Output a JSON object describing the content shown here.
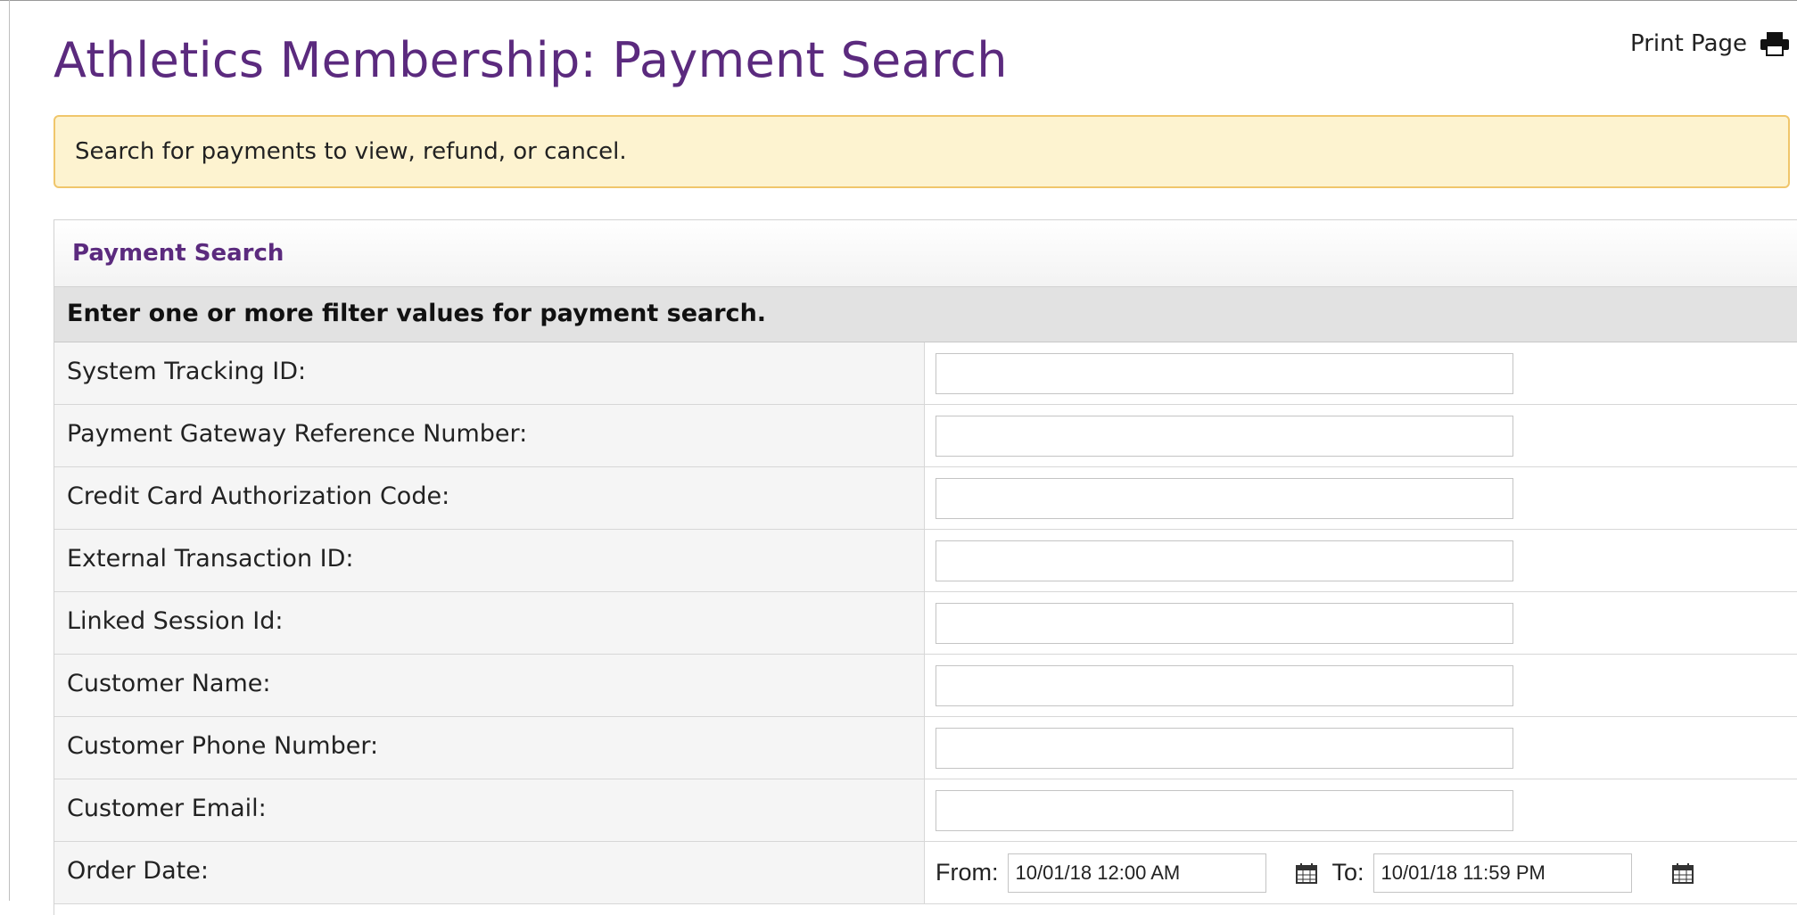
{
  "page": {
    "title": "Athletics Membership: Payment Search",
    "print_label": "Print Page"
  },
  "alert": {
    "text": "Search for payments to view, refund, or cancel."
  },
  "panel": {
    "header": "Payment Search",
    "instructions": "Enter one or more filter values for payment search.",
    "fields": [
      {
        "label": "System Tracking ID:",
        "value": ""
      },
      {
        "label": "Payment Gateway Reference Number:",
        "value": ""
      },
      {
        "label": "Credit Card Authorization Code:",
        "value": ""
      },
      {
        "label": "External Transaction ID:",
        "value": ""
      },
      {
        "label": "Linked Session Id:",
        "value": ""
      },
      {
        "label": "Customer Name:",
        "value": ""
      },
      {
        "label": "Customer Phone Number:",
        "value": ""
      },
      {
        "label": "Customer Email:",
        "value": ""
      }
    ],
    "order_date": {
      "label": "Order Date:",
      "from_label": "From:",
      "from_value": "10/01/18 12:00 AM",
      "to_label": "To:",
      "to_value": "10/01/18 11:59 PM"
    }
  },
  "icons": {
    "print": "printer-icon",
    "calendar": "calendar-icon"
  },
  "colors": {
    "title": "#5b2a7e",
    "alert_bg": "#fdf3d0",
    "alert_border": "#f0c66b",
    "subheader_bg": "#e2e2e2",
    "label_bg": "#f5f5f5"
  }
}
